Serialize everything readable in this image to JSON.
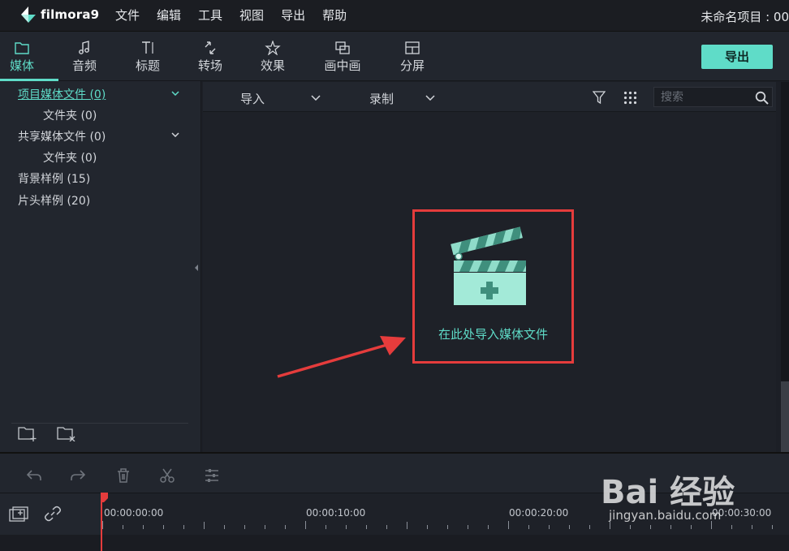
{
  "app": {
    "logo_text": "filmora9",
    "project_name": "未命名项目 : 00"
  },
  "menu": [
    "文件",
    "编辑",
    "工具",
    "视图",
    "导出",
    "帮助"
  ],
  "tabs": [
    {
      "label": "媒体",
      "icon": "folder-icon"
    },
    {
      "label": "音频",
      "icon": "music-note-icon"
    },
    {
      "label": "标题",
      "icon": "title-text-icon"
    },
    {
      "label": "转场",
      "icon": "transition-icon"
    },
    {
      "label": "效果",
      "icon": "effects-icon"
    },
    {
      "label": "画中画",
      "icon": "pip-icon"
    },
    {
      "label": "分屏",
      "icon": "split-screen-icon"
    }
  ],
  "export_button": "导出",
  "media_tree": [
    {
      "label": "项目媒体文件 (0)",
      "active": true,
      "expandable": true
    },
    {
      "label": "文件夹 (0)",
      "active": false,
      "expandable": false
    },
    {
      "label": "共享媒体文件 (0)",
      "active": false,
      "expandable": true
    },
    {
      "label": "文件夹 (0)",
      "active": false,
      "expandable": false
    },
    {
      "label": "背景样例 (15)",
      "active": false,
      "expandable": false
    },
    {
      "label": "片头样例 (20)",
      "active": false,
      "expandable": false
    }
  ],
  "media_toolbar": {
    "import_label": "导入",
    "record_label": "录制",
    "search_placeholder": "搜索"
  },
  "import_hint": "在此处导入媒体文件",
  "timeline": {
    "time_labels": [
      "00:00:00:00",
      "00:00:10:00",
      "00:00:20:00",
      "00:00:30:00"
    ]
  },
  "watermark": {
    "brand": "Bai 经验",
    "url": "jingyan.baidu.com"
  },
  "colors": {
    "accent": "#5fdcc8",
    "highlight_box": "#e53c3c",
    "playhead": "#e53c3c"
  }
}
